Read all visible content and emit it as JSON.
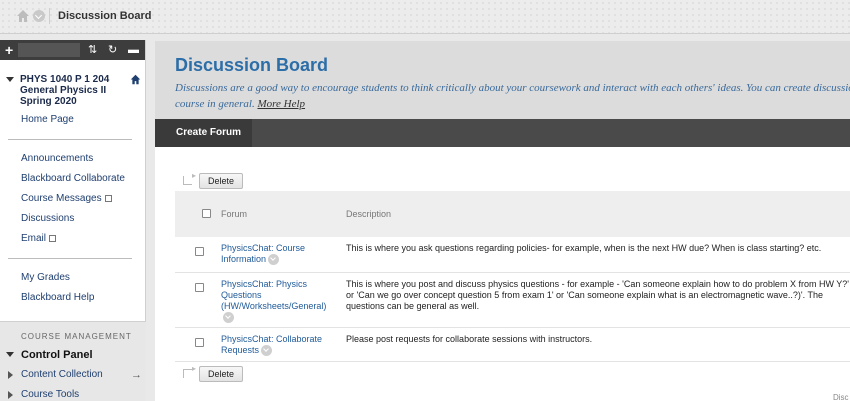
{
  "breadcrumb": {
    "current": "Discussion Board"
  },
  "sidebar": {
    "course_title": "PHYS 1040 P 1 204 General Physics II Spring 2020",
    "items": [
      {
        "label": "Home Page"
      },
      {
        "label": "Announcements"
      },
      {
        "label": "Blackboard Collaborate"
      },
      {
        "label": "Course Messages"
      },
      {
        "label": "Discussions"
      },
      {
        "label": "Email"
      },
      {
        "label": "My Grades"
      },
      {
        "label": "Blackboard Help"
      }
    ],
    "management_label": "COURSE MANAGEMENT",
    "control_panel_label": "Control Panel",
    "cp_items": [
      {
        "label": "Content Collection"
      },
      {
        "label": "Course Tools"
      }
    ]
  },
  "page": {
    "title": "Discussion Board",
    "description": "Discussions are a good way to encourage students to think critically about your coursework and interact with each others' ideas. You can create discussio",
    "description_line2": "course in general.",
    "more_help": "More Help"
  },
  "actionbar": {
    "create_forum": "Create Forum"
  },
  "table": {
    "delete_label": "Delete",
    "columns": [
      "Forum",
      "Description"
    ],
    "rows": [
      {
        "forum": "PhysicsChat: Course Information",
        "description": "This is where you ask questions regarding policies- for example, when is the next HW due? When is class starting? etc."
      },
      {
        "forum": "PhysicsChat: Physics Questions (HW/Worksheets/General)",
        "description": "This is where you post and discuss physics questions - for example - 'Can someone explain how to do problem X from HW Y?' or 'Can we go over concept question 5 from exam 1' or 'Can someone explain what is an electromagnetic wave..?)'. The questions can be general as well."
      },
      {
        "forum": "PhysicsChat: Collaborate Requests",
        "description": "Please post requests for collaborate sessions with instructors."
      }
    ]
  },
  "footer": {
    "partial": "Disc"
  },
  "colors": {
    "title_blue": "#2c6ea8",
    "link_blue": "#1f3f70",
    "dark_bar": "#4a4a4a"
  }
}
